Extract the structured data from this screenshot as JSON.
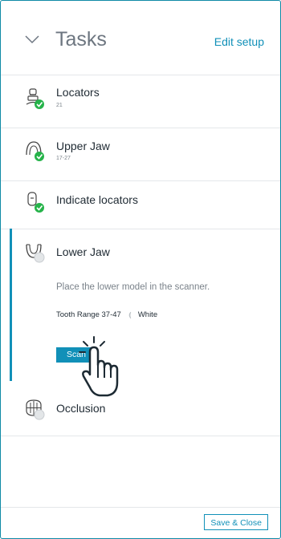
{
  "header": {
    "title": "Tasks",
    "edit_setup_label": "Edit setup"
  },
  "tasks": [
    {
      "label": "Locators",
      "sub": "21",
      "status": "done",
      "icon": "locator-icon"
    },
    {
      "label": "Upper Jaw",
      "sub": "17-27",
      "status": "done",
      "icon": "upper-jaw-icon"
    },
    {
      "label": "Indicate locators",
      "sub": "",
      "status": "done",
      "icon": "indicate-locators-icon"
    },
    {
      "label": "Lower Jaw",
      "sub": "",
      "status": "pending",
      "icon": "lower-jaw-icon",
      "description": "Place the lower model in the scanner.",
      "tooth_range": "Tooth Range 37-47",
      "color_label": "White",
      "scan_label": "Scan"
    },
    {
      "label": "Occlusion",
      "sub": "",
      "status": "pending",
      "icon": "occlusion-icon"
    }
  ],
  "footer": {
    "save_close_label": "Save & Close"
  },
  "colors": {
    "accent": "#1190b8",
    "done": "#26b34a",
    "pending": "#c9cdd1"
  }
}
